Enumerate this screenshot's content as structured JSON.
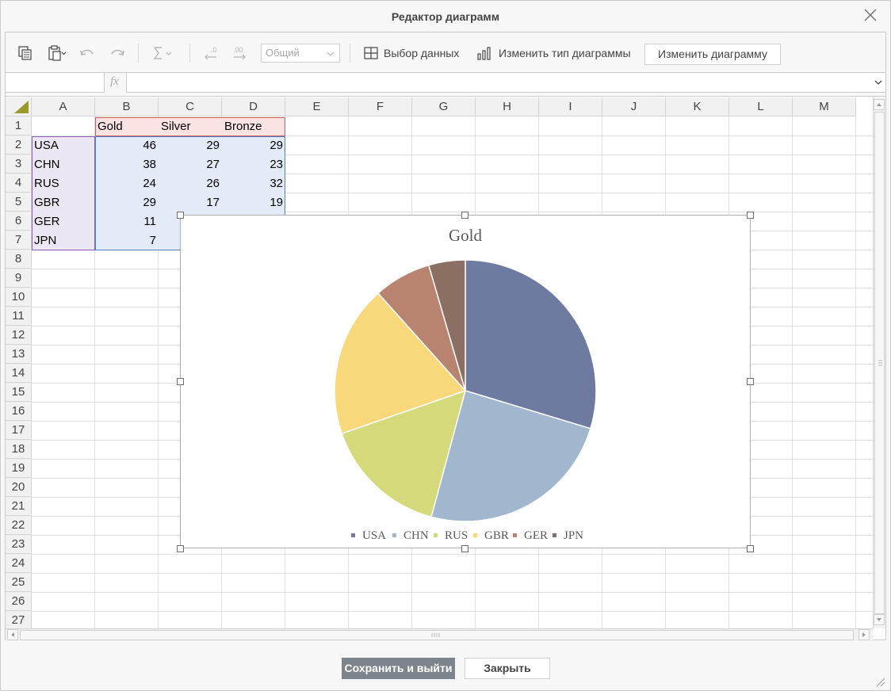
{
  "dialog": {
    "title": "Редактор диаграмм"
  },
  "toolbar": {
    "format_combo": "Общий",
    "select_data_label": "Выбор данных",
    "change_type_label": "Изменить тип диаграммы",
    "edit_chart_label": "Изменить диаграмму"
  },
  "formula_bar": {
    "fx_label": "fx",
    "name_value": "",
    "formula_value": ""
  },
  "columns": [
    "A",
    "B",
    "C",
    "D",
    "E",
    "F",
    "G",
    "H",
    "I",
    "J",
    "K",
    "L",
    "M"
  ],
  "rows": [
    "1",
    "2",
    "3",
    "4",
    "5",
    "6",
    "7",
    "8",
    "9",
    "10",
    "11",
    "12",
    "13",
    "14",
    "15",
    "16",
    "17",
    "18",
    "19",
    "20",
    "21",
    "22",
    "23",
    "24",
    "25",
    "26",
    "27"
  ],
  "sheet": {
    "headers": [
      "",
      "Gold",
      "Silver",
      "Bronze"
    ],
    "data": [
      {
        "country": "USA",
        "gold": "46",
        "silver": "29",
        "bronze": "29"
      },
      {
        "country": "CHN",
        "gold": "38",
        "silver": "27",
        "bronze": "23"
      },
      {
        "country": "RUS",
        "gold": "24",
        "silver": "26",
        "bronze": "32"
      },
      {
        "country": "GBR",
        "gold": "29",
        "silver": "17",
        "bronze": "19"
      },
      {
        "country": "GER",
        "gold": "11",
        "silver": "",
        "bronze": ""
      },
      {
        "country": "JPN",
        "gold": "7",
        "silver": "",
        "bronze": ""
      }
    ]
  },
  "chart_data": {
    "type": "pie",
    "title": "Gold",
    "categories": [
      "USA",
      "CHN",
      "RUS",
      "GBR",
      "GER",
      "JPN"
    ],
    "values": [
      46,
      38,
      24,
      29,
      11,
      7
    ],
    "colors": [
      "#6f7aa0",
      "#a1b7cd",
      "#d4da79",
      "#f9d77b",
      "#b88470",
      "#8c6f63"
    ],
    "legend": "bottom"
  },
  "footer": {
    "save_label": "Сохранить и выйти",
    "close_label": "Закрыть"
  }
}
